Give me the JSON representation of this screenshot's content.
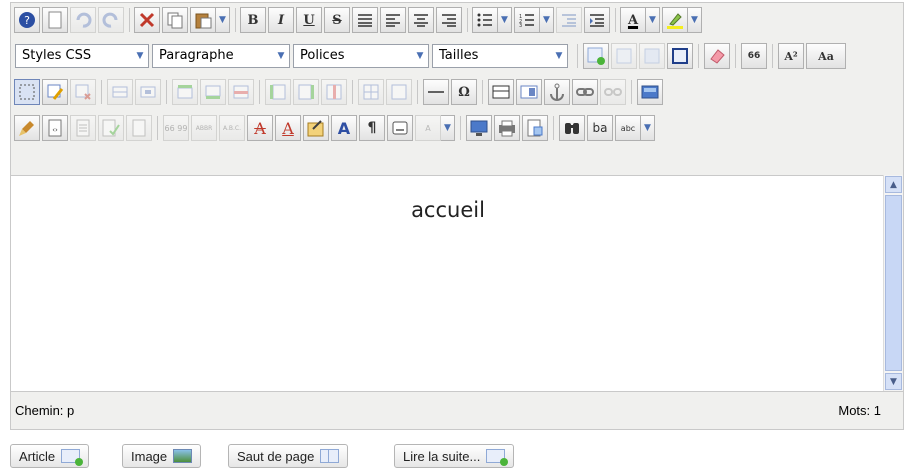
{
  "toolbar": {
    "row3": {
      "omega_label": "Ω"
    },
    "row2": {
      "styles_select": "Styles CSS",
      "format_select": "Paragraphe",
      "fonts_select": "Polices",
      "sizes_select": "Tailles",
      "quote_label": "66",
      "superscript_label": "A²",
      "font_label": "Aa"
    },
    "row1": {
      "bold_label": "B",
      "italic_label": "I",
      "underline_label": "U",
      "strike_label": "S",
      "textcolor_label": "A"
    },
    "row4": {
      "cite_label": "66 99",
      "abbr_label": "ABBR",
      "acronym_label": "A.B.C.",
      "del_label": "A",
      "ins_label": "A",
      "pilcrow_label": "¶",
      "spell_label": "abc",
      "ba_label": "ba"
    }
  },
  "content": {
    "text": "accueil"
  },
  "status": {
    "path": "Chemin: p",
    "word_count": "Mots: 1"
  },
  "buttons": {
    "article": "Article",
    "image": "Image",
    "pagebreak": "Saut de page",
    "readmore": "Lire la suite..."
  }
}
